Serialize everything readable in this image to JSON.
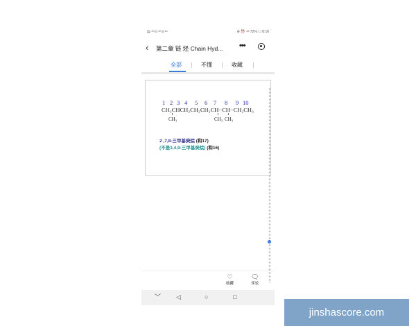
{
  "statusbar": {
    "left": "▤ ⁴ᴳ.ıl ⁴ᴳ.ıl ²⁹",
    "right": "⊛ ⏰ ⁴ᴳ 72% ▭ 8:16"
  },
  "header": {
    "back_icon": "back-arrow-icon",
    "title": "第二章 链 烃 Chain Hyd...",
    "more_icon": "more-dots-icon",
    "close_icon": "target-circle-icon"
  },
  "tabs": [
    {
      "label": "全部",
      "active": true
    },
    {
      "label": "不懂",
      "active": false
    },
    {
      "label": "收藏",
      "active": false
    }
  ],
  "content": {
    "numbers": [
      "1",
      "2",
      "3",
      "4",
      "5",
      "6",
      "7",
      "8",
      "9",
      "10"
    ],
    "chain_main": "CH₃CHCH₂CH₂CH₂CH−CH−CH₂CH₃",
    "branch_1": "CH₃",
    "branch_2": "CH₃",
    "branch_3": "CH₃",
    "answer_1_name": "2 ,7,8-三甲基癸烷",
    "answer_1_sum": " (和17)",
    "answer_2_name": "(不是3,4,9-三甲基癸烷)",
    "answer_2_sum": " (和16)"
  },
  "bottom_bar": {
    "favorite_label": "收藏",
    "favorite_icon": "heart-icon",
    "comment_label": "评论",
    "comment_icon": "speech-bubble-icon"
  },
  "nav_bar": {
    "down": "﹀",
    "back": "◁",
    "home": "○",
    "recent": "□"
  },
  "watermark": "jinshascore.com",
  "colors": {
    "accent": "#3a7bd5",
    "number_blue": "#2f2fb0",
    "teal": "#1f8f8f",
    "watermark_bg": "#7fa4c8"
  }
}
